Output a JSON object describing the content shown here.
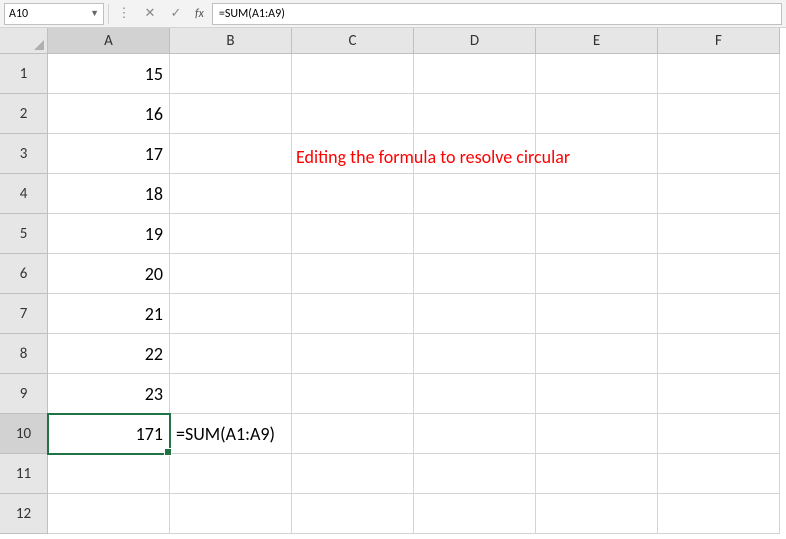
{
  "nameBox": {
    "value": "A10"
  },
  "formulaBar": {
    "fxLabel": "fx",
    "value": "=SUM(A1:A9)"
  },
  "columns": [
    "A",
    "B",
    "C",
    "D",
    "E",
    "F"
  ],
  "rowCount": 12,
  "selectedCol": "A",
  "selectedRow": 10,
  "activeCell": "A10",
  "cells": {
    "A1": "15",
    "A2": "16",
    "A3": "17",
    "A4": "18",
    "A5": "19",
    "A6": "20",
    "A7": "21",
    "A8": "22",
    "A9": "23",
    "A10": "171",
    "B10": "=SUM(A1:A9)"
  },
  "annotation": "Editing the formula to resolve circular",
  "icons": {
    "options": "⋮",
    "cancel": "✕",
    "enter": "✓"
  }
}
